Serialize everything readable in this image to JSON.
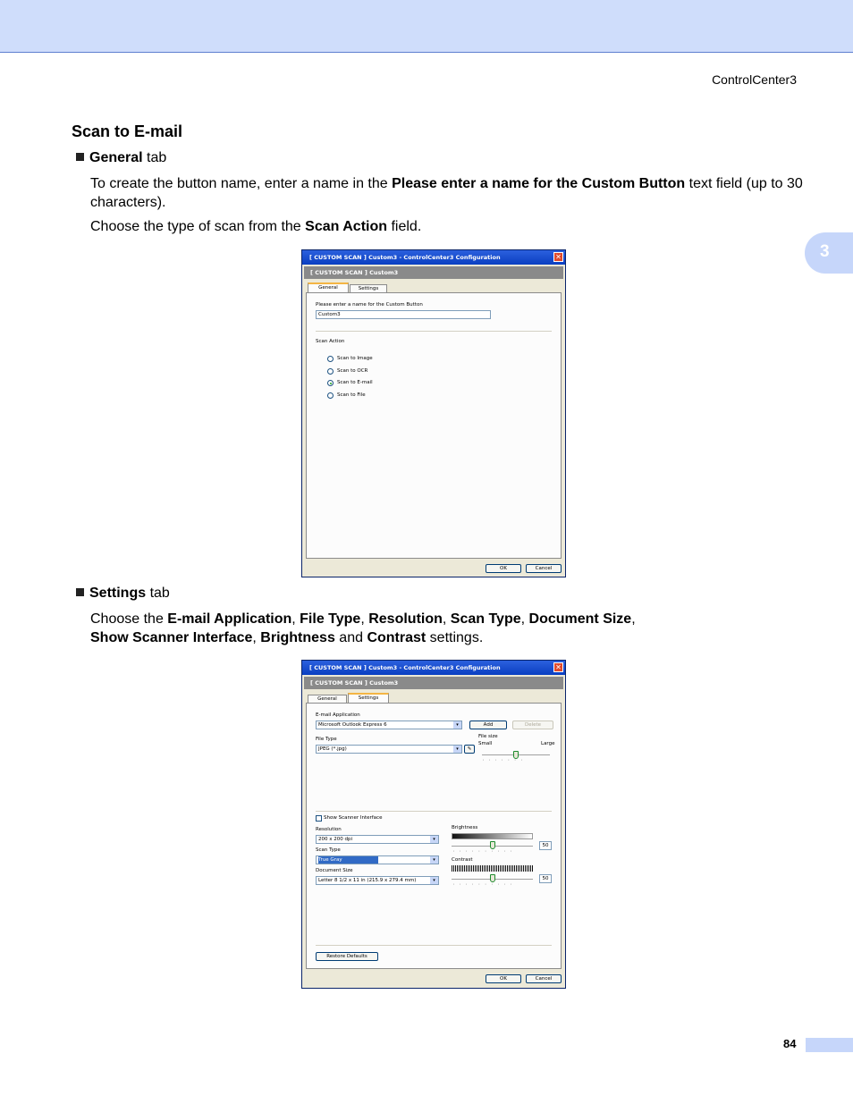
{
  "header": {
    "running_title": "ControlCenter3"
  },
  "chapter": {
    "number": "3"
  },
  "section": {
    "title": "Scan to E-mail"
  },
  "general_bullet": {
    "name": "General",
    "suffix": " tab"
  },
  "general_text": {
    "p1_a": "To create the button name, enter a name in the ",
    "p1_b": "Please enter a name for the Custom Button",
    "p1_c": " text field (up to 30 characters).",
    "p2_a": "Choose the type of scan from the ",
    "p2_b": "Scan Action",
    "p2_c": " field."
  },
  "settings_bullet": {
    "name": "Settings",
    "suffix": " tab"
  },
  "settings_text": {
    "a": "Choose the ",
    "email_app": "E-mail Application",
    "comma1": ", ",
    "file_type": "File Type",
    "comma2": ", ",
    "resolution": "Resolution",
    "comma3": ", ",
    "scan_type": "Scan Type",
    "comma4": ", ",
    "doc_size": "Document Size",
    "comma5": ",",
    "show_scanner": "Show Scanner Interface",
    "comma6": ", ",
    "brightness": "Brightness",
    "and": " and ",
    "contrast": "Contrast",
    "end": " settings."
  },
  "dialog": {
    "title": "[  CUSTOM SCAN  ]   Custom3 - ControlCenter3 Configuration",
    "banner": "[  CUSTOM SCAN  ]   Custom3",
    "tab_general": "General",
    "tab_settings": "Settings",
    "ok": "OK",
    "cancel": "Cancel"
  },
  "general_tab": {
    "name_label": "Please enter a name for the Custom Button",
    "name_value": "Custom3",
    "scan_action_label": "Scan Action",
    "options": [
      "Scan to Image",
      "Scan to OCR",
      "Scan to E-mail",
      "Scan to File"
    ],
    "selected_option": "Scan to E-mail"
  },
  "settings_tab": {
    "email_app_label": "E-mail Application",
    "email_app_value": "Microsoft Outlook Express 6",
    "add": "Add",
    "delete": "Delete",
    "file_type_label": "File Type",
    "file_type_value": "JPEG (*.jpg)",
    "file_size_label": "File size",
    "small": "Small",
    "large": "Large",
    "show_scanner_label": "Show Scanner Interface",
    "resolution_label": "Resolution",
    "resolution_value": "200 x 200 dpi",
    "scan_type_label": "Scan Type",
    "scan_type_value": "True Gray",
    "doc_size_label": "Document Size",
    "doc_size_value": "Letter 8 1/2 x 11 in (215.9 x 279.4 mm)",
    "brightness_label": "Brightness",
    "brightness_value": "50",
    "contrast_label": "Contrast",
    "contrast_value": "50",
    "restore": "Restore Defaults"
  },
  "footer": {
    "page_number": "84"
  }
}
